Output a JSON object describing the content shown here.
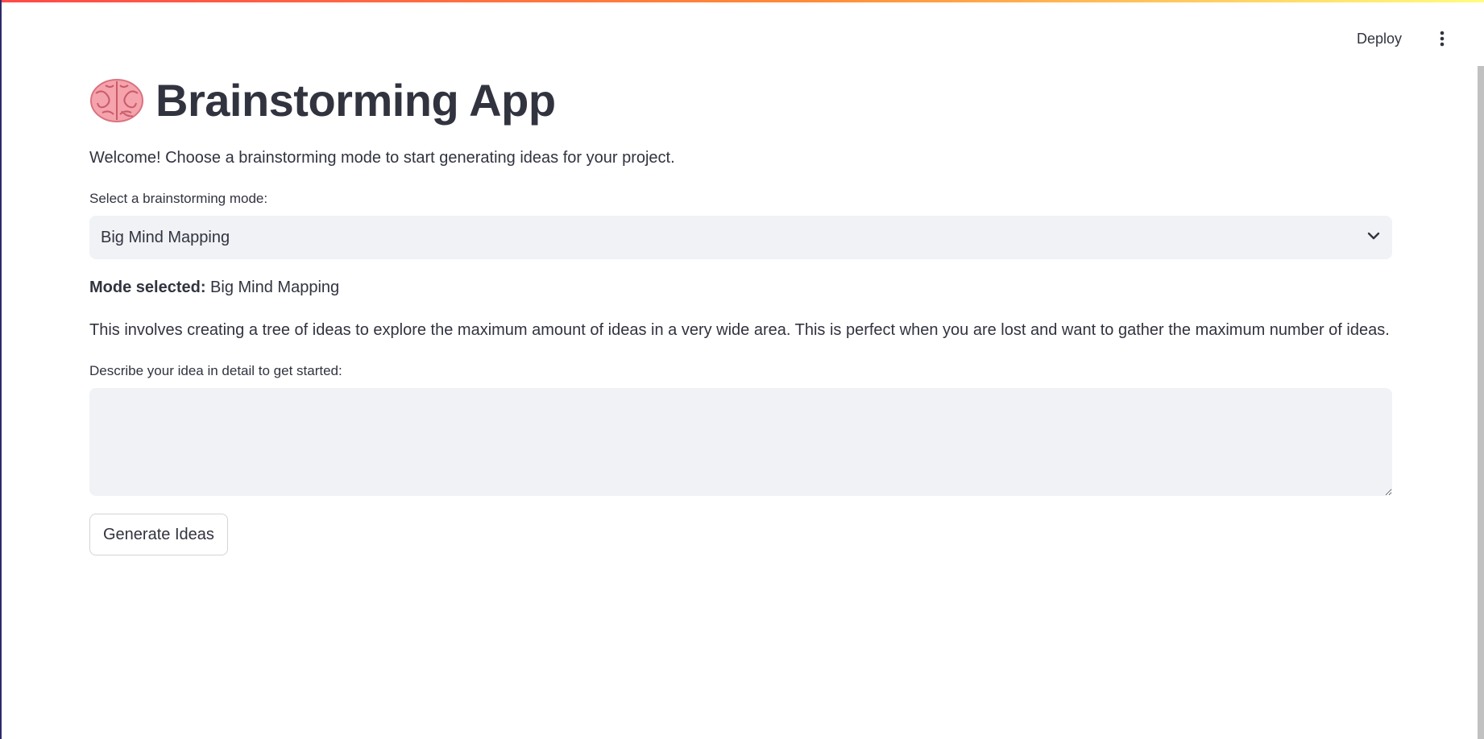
{
  "header": {
    "deploy_label": "Deploy",
    "menu_icon": "more-vertical-icon"
  },
  "app": {
    "title_icon": "brain-icon",
    "title": "Brainstorming App",
    "welcome": "Welcome! Choose a brainstorming mode to start generating ideas for your project."
  },
  "mode_select": {
    "label": "Select a brainstorming mode:",
    "selected": "Big Mind Mapping",
    "chevron_icon": "chevron-down-icon"
  },
  "mode_info": {
    "prefix": "Mode selected:",
    "value": "Big Mind Mapping",
    "description": "This involves creating a tree of ideas to explore the maximum amount of ideas in a very wide area. This is perfect when you are lost and want to gather the maximum number of ideas."
  },
  "idea_input": {
    "label": "Describe your idea in detail to get started:",
    "value": "",
    "placeholder": ""
  },
  "actions": {
    "generate_label": "Generate Ideas"
  },
  "colors": {
    "text": "#31333f",
    "input_bg": "#f0f2f6",
    "accent_start": "#ff4b4b",
    "accent_end": "#fffd80"
  }
}
